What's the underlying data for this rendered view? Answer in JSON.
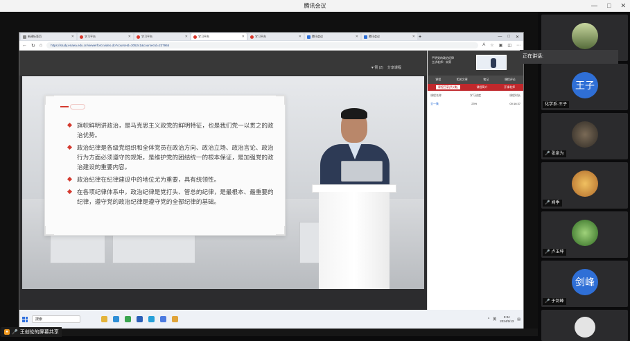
{
  "meeting": {
    "title": "腾讯会议",
    "controls": [
      "—",
      "□",
      "✕"
    ],
    "share_label": "王创伦的屏幕共享",
    "speaking_label": "正在讲话:"
  },
  "browser": {
    "tabs": [
      {
        "label": "新建标签页",
        "icon": "blank"
      },
      {
        "label": "学习平台",
        "icon": "red"
      },
      {
        "label": "学习平台",
        "icon": "red"
      },
      {
        "label": "学习平台",
        "icon": "red",
        "active": true
      },
      {
        "label": "学习平台",
        "icon": "red"
      },
      {
        "label": "腾讯会议",
        "icon": "blue"
      },
      {
        "label": "腾讯会议",
        "icon": "blue"
      }
    ],
    "url": "https://study.enaea.edu.cn/viewerforccvideo.do?courseId=305241&coursecId=237965",
    "window_controls": [
      "—",
      "□",
      "✕"
    ]
  },
  "player": {
    "like_label": "♥ 赞 (2)",
    "share_label": "分享课程"
  },
  "slide": {
    "bullets": [
      "旗帜鲜明讲政治，是马克思主义政党的鲜明特征，也是我们党一以贯之的政治优势。",
      "政治纪律是各级党组织和全体党员在政治方向、政治立场、政治言论、政治行为方面必须遵守的规矩，是维护党的团结统一的根本保证，是加强党的政治建设的重要内容。",
      "政治纪律在纪律建设中的地位尤为重要，具有统领性。",
      "在各项纪律体系中，政治纪律是党打头、管总的纪律，是最根本、最重要的纪律，遵守党的政治纪律是遵守党的全部纪律的基础。"
    ]
  },
  "side_panel": {
    "header_lines": [
      "严明党的政治纪律",
      "主讲老师：宋荣"
    ],
    "tabs": [
      "课程",
      "相关文章",
      "笔记",
      "课程评论"
    ],
    "red_tabs": [
      "课程目录(共1集)",
      "课程简介",
      "开课老师"
    ],
    "columns": [
      "课程名称",
      "学习进度",
      "课程时长"
    ],
    "row": {
      "name": "全一集",
      "progress": "23%",
      "duration": "00:16:37"
    }
  },
  "taskbar": {
    "search": "搜索",
    "tray_text": "英",
    "time": "9:34",
    "date": "2024/5/13"
  },
  "participants": [
    {
      "name": "",
      "avatar": "photo-landscape",
      "color": "#556b3a"
    },
    {
      "name": "化学系·王子",
      "avatar_text": "王子",
      "color": "#2f6fd6"
    },
    {
      "name": "张泉为",
      "avatar": "photo-person",
      "color": "#3b3b3b"
    },
    {
      "name": "闻季",
      "avatar": "photo-cartoon",
      "color": "#c7893c"
    },
    {
      "name": "卢玉坤",
      "avatar": "photo-nature",
      "color": "#3f7a2d"
    },
    {
      "name": "于剑峰",
      "avatar_text": "剑峰",
      "color": "#2f6fd6"
    },
    {
      "name": "",
      "avatar": "photo-default",
      "color": "#d8d8d8"
    }
  ]
}
